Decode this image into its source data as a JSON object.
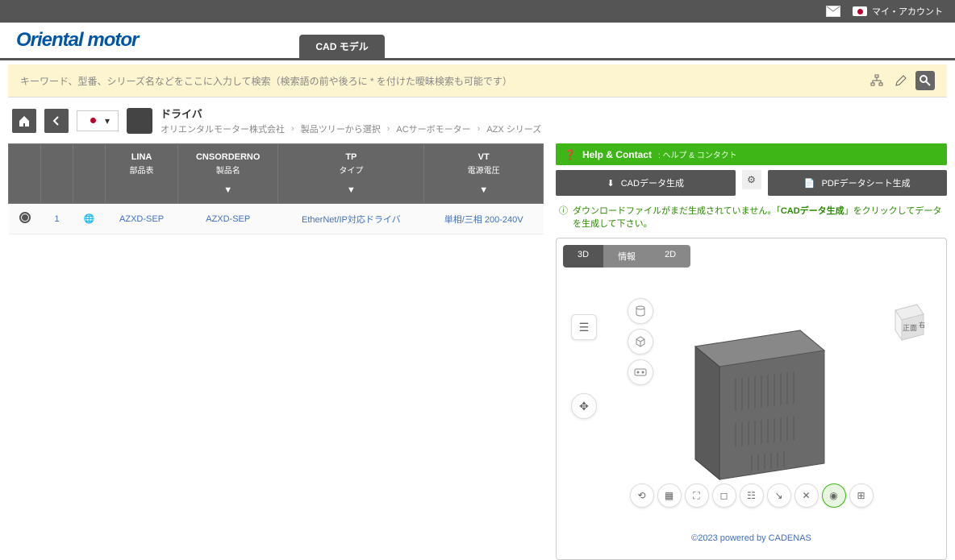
{
  "topbar": {
    "account_label": "マイ・アカウント"
  },
  "header": {
    "logo": "Oriental motor",
    "tab_cad": "CAD モデル"
  },
  "search": {
    "placeholder": "キーワード、型番、シリーズ名などをここに入力して検索（検索語の前や後ろに * を付けた曖昧検索も可能です）"
  },
  "breadcrumb": {
    "title": "ドライバ",
    "path": [
      "オリエンタルモーター株式会社",
      "製品ツリーから選択",
      "ACサーボモーター",
      "AZX シリーズ"
    ]
  },
  "table": {
    "headers": [
      {
        "label": "LINA",
        "sub": "部品表"
      },
      {
        "label": "CNSORDERNO",
        "sub": "製品名"
      },
      {
        "label": "TP",
        "sub": "タイプ"
      },
      {
        "label": "VT",
        "sub": "電源電圧"
      }
    ],
    "row": {
      "num": "1",
      "lina": "AZXD-SEP",
      "orderno": "AZXD-SEP",
      "tp": "EtherNet/IP対応ドライバ",
      "vt": "単相/三相 200-240V"
    }
  },
  "help": {
    "title": "Help & Contact",
    "sub": ": ヘルプ & コンタクト"
  },
  "actions": {
    "cad": "CADデータ生成",
    "pdf": "PDFデータシート生成"
  },
  "warning": {
    "pre": "ダウンロードファイルがまだ生成されていません。「",
    "bold": "CADデータ生成",
    "post": "」をクリックしてデータを生成して下さい。"
  },
  "viewer": {
    "tabs": {
      "t3d": "3D",
      "info": "情報",
      "t2d": "2D"
    },
    "cube_face": "正面",
    "cube_side": "右"
  },
  "footer": {
    "credit": "©2023 powered by CADENAS"
  }
}
